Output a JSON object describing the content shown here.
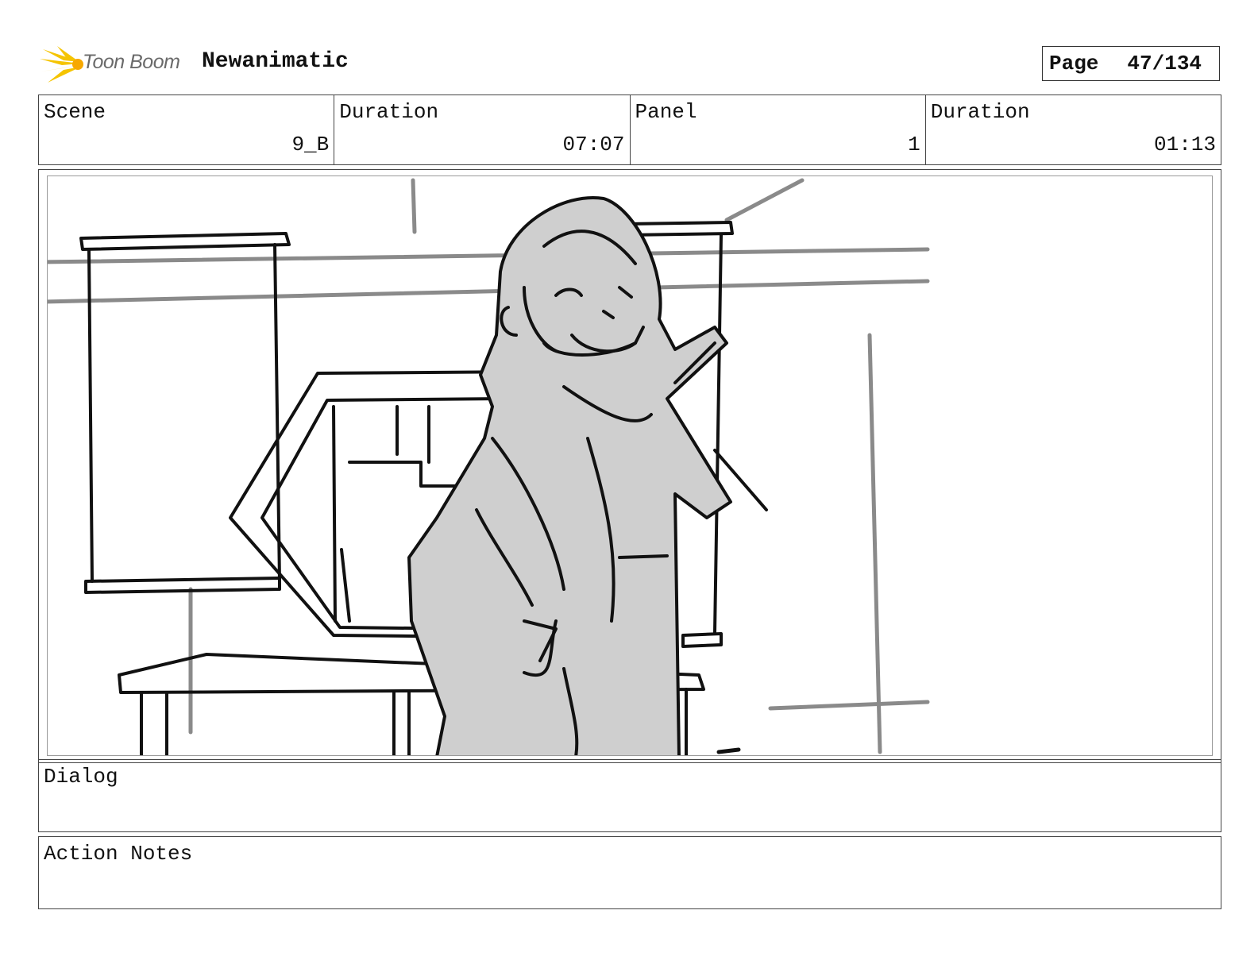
{
  "header": {
    "logo_text": "Toon Boom",
    "project_title": "Newanimatic",
    "page_label": "Page",
    "page_number": "47/134"
  },
  "info": {
    "scene_label": "Scene",
    "scene_value": "9_B",
    "scene_duration_label": "Duration",
    "scene_duration_value": "07:07",
    "panel_label": "Panel",
    "panel_value": "1",
    "panel_duration_label": "Duration",
    "panel_duration_value": "01:13"
  },
  "dialog": {
    "label": "Dialog",
    "text": ""
  },
  "action_notes": {
    "label": "Action Notes",
    "text": ""
  },
  "colors": {
    "logo_accent": "#f5c400",
    "sketch_fill": "#cfcfcf",
    "line": "#111111"
  }
}
